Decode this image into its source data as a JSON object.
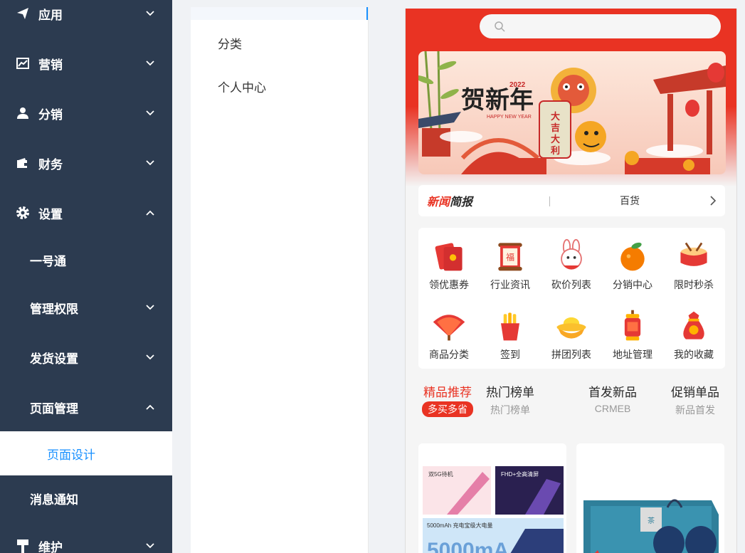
{
  "sidebar": {
    "items": [
      {
        "label": "应用",
        "icon": "send-icon",
        "expanded": false
      },
      {
        "label": "营销",
        "icon": "chart-icon",
        "expanded": false
      },
      {
        "label": "分销",
        "icon": "user-icon",
        "expanded": false
      },
      {
        "label": "财务",
        "icon": "wallet-icon",
        "expanded": false
      },
      {
        "label": "设置",
        "icon": "gear-icon",
        "expanded": true
      },
      {
        "label": "维护",
        "icon": "hammer-icon",
        "expanded": false
      }
    ],
    "sub_items": [
      {
        "label": "一号通"
      },
      {
        "label": "管理权限"
      },
      {
        "label": "发货设置"
      },
      {
        "label": "页面管理"
      },
      {
        "label": "页面设计",
        "active": true
      },
      {
        "label": "消息通知"
      }
    ],
    "colors": {
      "bg": "#2c3b50",
      "active_text": "#1890ff"
    }
  },
  "page_list": {
    "items": [
      {
        "label": "分类"
      },
      {
        "label": "个人中心"
      }
    ]
  },
  "preview": {
    "search": {
      "placeholder": ""
    },
    "banner": {
      "text": "贺新年",
      "year": "2022",
      "sub": "HAPPY NEW YEAR",
      "lantern_text": "大吉大利"
    },
    "news": {
      "logo_part1": "新闻",
      "logo_part2": "简报",
      "text": "百货"
    },
    "menus": [
      {
        "label": "领优惠券",
        "icon": "red-envelope-icon"
      },
      {
        "label": "行业资讯",
        "icon": "scroll-icon"
      },
      {
        "label": "砍价列表",
        "icon": "rabbit-icon"
      },
      {
        "label": "分销中心",
        "icon": "orange-icon"
      },
      {
        "label": "限时秒杀",
        "icon": "drum-icon"
      },
      {
        "label": "商品分类",
        "icon": "fan-icon"
      },
      {
        "label": "签到",
        "icon": "firecracker-icon"
      },
      {
        "label": "拼团列表",
        "icon": "ingot-icon"
      },
      {
        "label": "地址管理",
        "icon": "lantern-icon"
      },
      {
        "label": "我的收藏",
        "icon": "lucky-bag-icon"
      }
    ],
    "tabs": [
      {
        "title": "精品推荐",
        "sub": "多买多省",
        "active": true
      },
      {
        "title": "热门榜单",
        "sub": "热门榜单"
      },
      {
        "title": "首发新品",
        "sub": "CRMEB"
      },
      {
        "title": "促销单品",
        "sub": "新品首发"
      }
    ],
    "goods": [
      {
        "badge1": "双5G待机",
        "badge2": "FHD+全高清屏",
        "badge3": "5000mAh 充电宝级大电量",
        "big_text": "5000mA"
      },
      {
        "box_text": "茶"
      }
    ],
    "colors": {
      "theme": "#e93323"
    }
  }
}
